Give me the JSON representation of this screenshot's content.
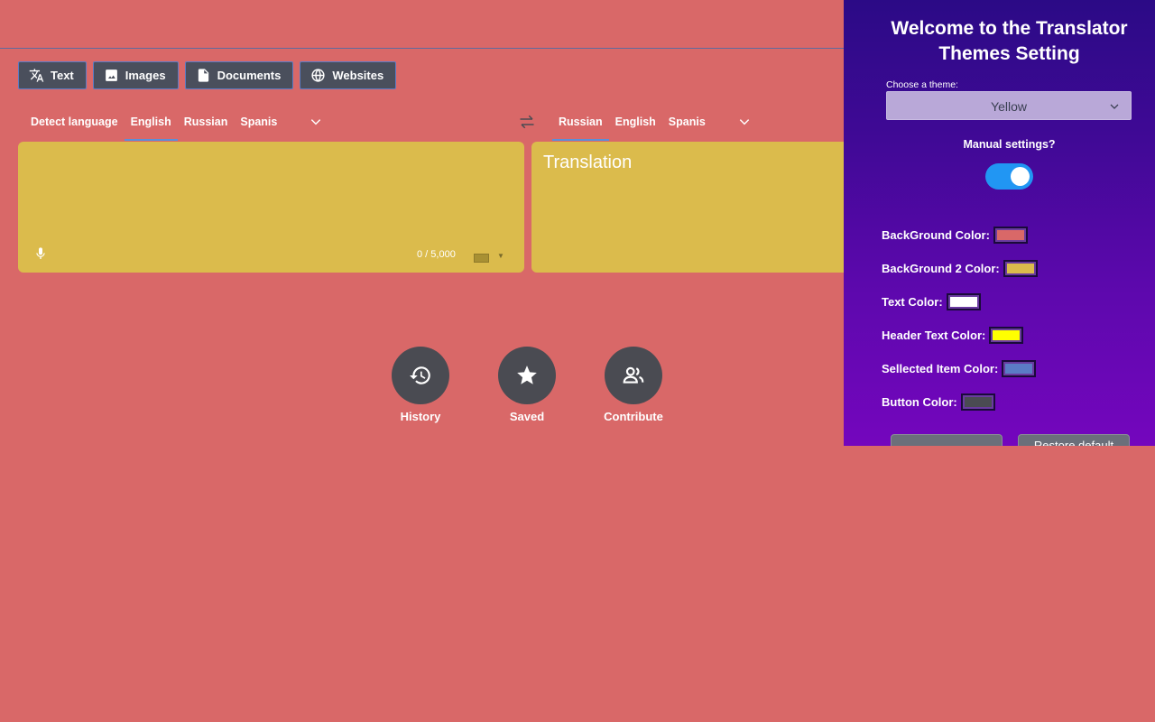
{
  "modes": [
    {
      "label": "Text",
      "icon": "translate-icon"
    },
    {
      "label": "Images",
      "icon": "image-icon"
    },
    {
      "label": "Documents",
      "icon": "document-icon"
    },
    {
      "label": "Websites",
      "icon": "globe-icon"
    }
  ],
  "source_languages": [
    "Detect language",
    "English",
    "Russian",
    "Spanis"
  ],
  "source_active": "English",
  "target_languages": [
    "Russian",
    "English",
    "Spanis"
  ],
  "target_active": "Russian",
  "source_pane": {
    "value": "",
    "char_count": "0 / 5,000"
  },
  "target_pane": {
    "placeholder": "Translation"
  },
  "actions": [
    {
      "label": "History",
      "icon": "history-icon"
    },
    {
      "label": "Saved",
      "icon": "star-icon"
    },
    {
      "label": "Contribute",
      "icon": "people-icon"
    }
  ],
  "panel": {
    "title_line1": "Welcome to the Translator",
    "title_line2": "Themes Setting",
    "theme_label": "Choose a theme:",
    "theme_value": "Yellow",
    "manual_label": "Manual settings?",
    "manual_enabled": true,
    "colors": [
      {
        "label": "BackGround Color:",
        "value": "#d96868"
      },
      {
        "label": "BackGround 2 Color:",
        "value": "#dbbb4c"
      },
      {
        "label": "Text Color:",
        "value": "#ffffff"
      },
      {
        "label": "Header Text Color:",
        "value": "#ffff00"
      },
      {
        "label": "Sellected Item Color:",
        "value": "#5b7bc5"
      },
      {
        "label": "Button Color:",
        "value": "#4a4b52"
      }
    ],
    "save_label": "",
    "restore_label": "Restore default"
  },
  "colors": {
    "page_background": "#d96868",
    "pane_background": "#dbbb4c",
    "button": "#4a4f5c",
    "accent": "#5b8fd9"
  }
}
